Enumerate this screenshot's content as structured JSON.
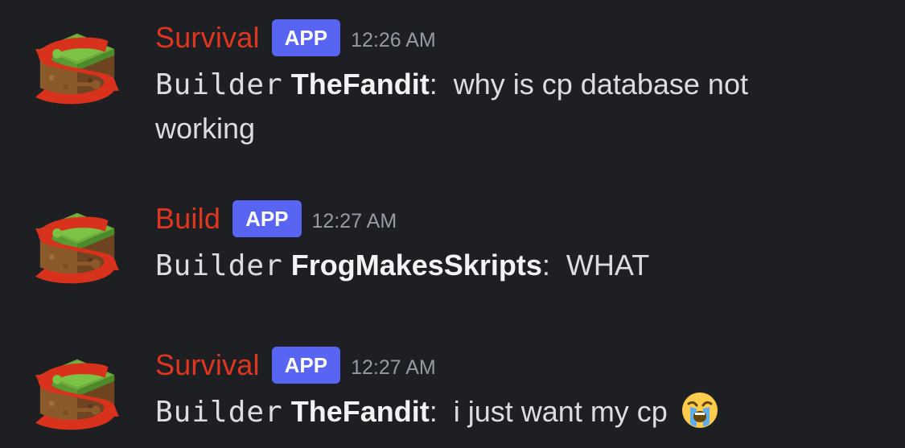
{
  "messages": [
    {
      "username": "Survival",
      "badge": "APP",
      "time": "12:26 AM",
      "rank": "Builder",
      "player": "TheFandit",
      "separator": ":",
      "text": "why is cp database not working",
      "avatar_icon": "minecraft-grass-block-logo-icon"
    },
    {
      "username": "Build",
      "badge": "APP",
      "time": "12:27 AM",
      "rank": "Builder",
      "player": "FrogMakesSkripts",
      "separator": ":",
      "text": "WHAT",
      "avatar_icon": "minecraft-grass-block-logo-icon"
    },
    {
      "username": "Survival",
      "badge": "APP",
      "time": "12:27 AM",
      "rank": "Builder",
      "player": "TheFandit",
      "separator": ":",
      "text": "i just want my cp",
      "emoji": "loudly-crying-face-emoji",
      "avatar_icon": "minecraft-grass-block-logo-icon"
    }
  ],
  "colors": {
    "background": "#1e1f22",
    "username": "#e0351f",
    "badge": "#5865f2",
    "timestamp": "#949ba4",
    "text": "#dbdee1"
  }
}
